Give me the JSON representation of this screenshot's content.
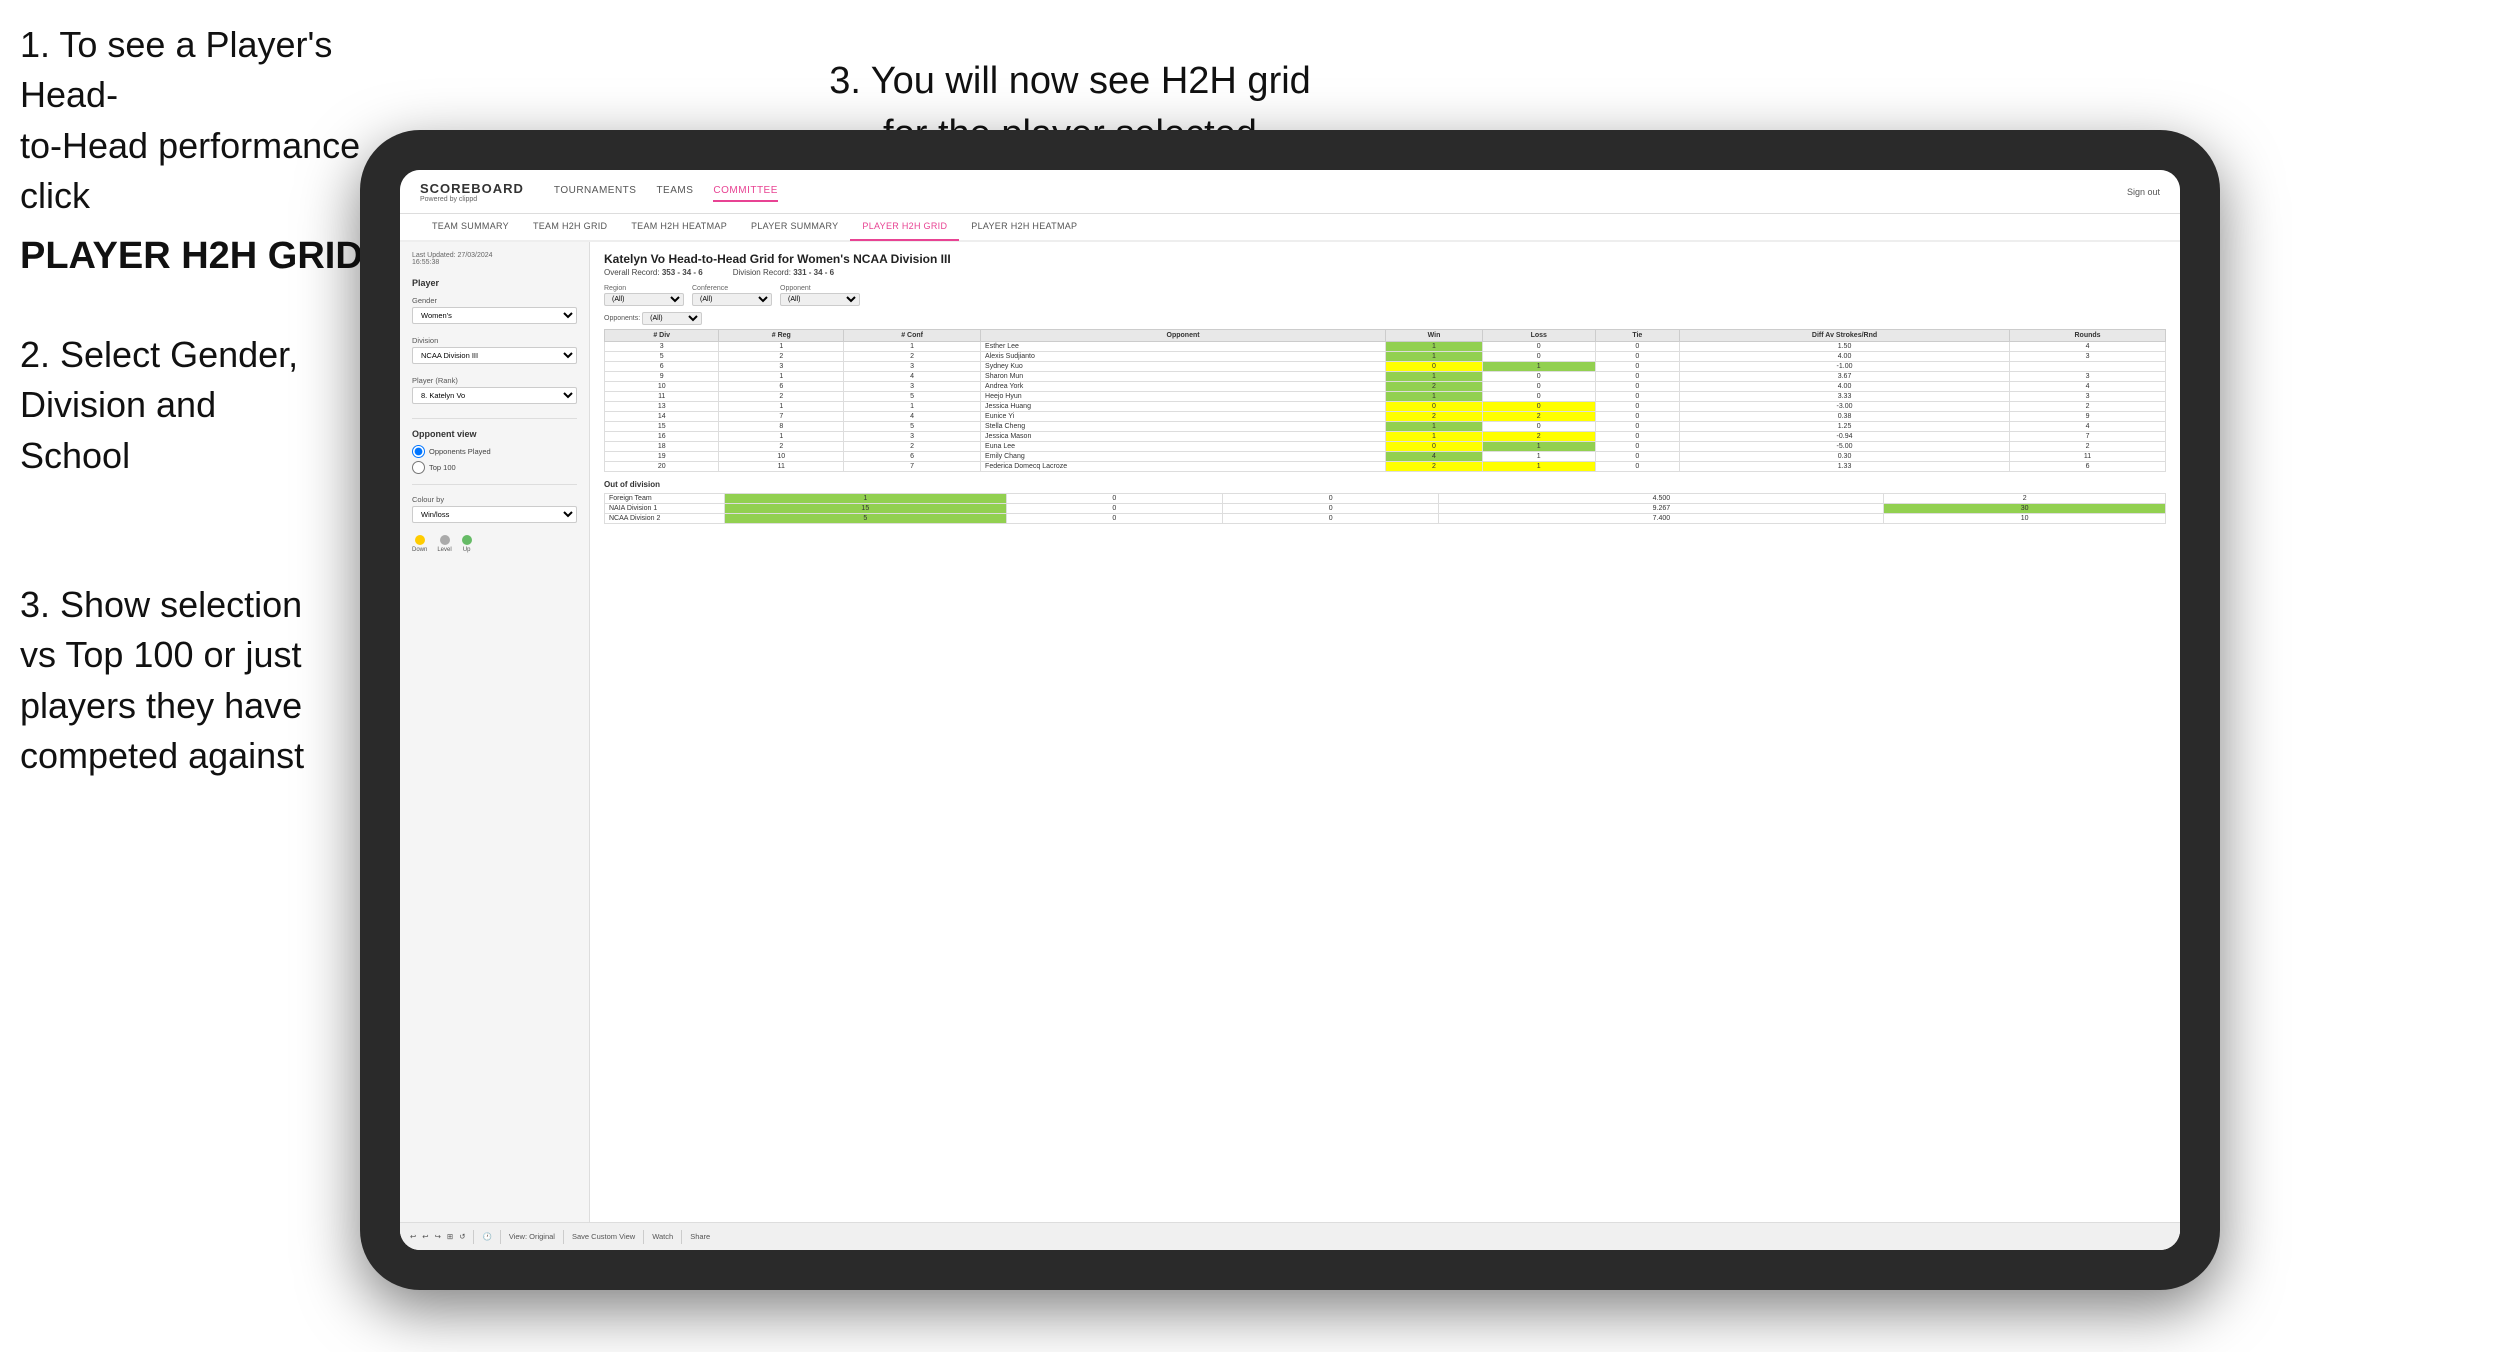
{
  "instructions": {
    "step1_line1": "1. To see a Player's Head-",
    "step1_line2": "to-Head performance click",
    "step1_bold": "PLAYER H2H GRID",
    "step2": "2. Select Gender,\nDivision and\nSchool",
    "step3_top_line1": "3. You will now see H2H grid",
    "step3_top_line2": "for the player selected",
    "step3_bottom": "3. Show selection\nvs Top 100 or just\nplayers they have\ncompeted against"
  },
  "nav": {
    "logo": "SCOREBOARD",
    "logo_sub": "Powered by clippd",
    "links": [
      "TOURNAMENTS",
      "TEAMS",
      "COMMITTEE"
    ],
    "active_link": "COMMITTEE",
    "sign_out": "Sign out"
  },
  "sub_nav": {
    "links": [
      "TEAM SUMMARY",
      "TEAM H2H GRID",
      "TEAM H2H HEATMAP",
      "PLAYER SUMMARY",
      "PLAYER H2H GRID",
      "PLAYER H2H HEATMAP"
    ],
    "active": "PLAYER H2H GRID"
  },
  "sidebar": {
    "timestamp": "Last Updated: 27/03/2024",
    "time": "16:55:38",
    "player_section": "Player",
    "gender_label": "Gender",
    "gender_value": "Women's",
    "division_label": "Division",
    "division_value": "NCAA Division III",
    "player_rank_label": "Player (Rank)",
    "player_rank_value": "8. Katelyn Vo",
    "opponent_view_label": "Opponent view",
    "opponents_played": "Opponents Played",
    "top_100": "Top 100",
    "colour_by": "Colour by",
    "colour_by_value": "Win/loss",
    "legend": {
      "down_label": "Down",
      "level_label": "Level",
      "up_label": "Up",
      "down_color": "#ffcc00",
      "level_color": "#aaaaaa",
      "up_color": "#66bb66"
    }
  },
  "grid": {
    "title": "Katelyn Vo Head-to-Head Grid for Women's NCAA Division III",
    "overall_record_label": "Overall Record:",
    "overall_record": "353 - 34 - 6",
    "division_record_label": "Division Record:",
    "division_record": "331 - 34 - 6",
    "region_filter_label": "Region",
    "conference_filter_label": "Conference",
    "opponent_filter_label": "Opponent",
    "opponents_label": "Opponents:",
    "filter_all": "(All)",
    "col_headers": [
      "# Div",
      "# Reg",
      "# Conf",
      "Opponent",
      "Win",
      "Loss",
      "Tie",
      "Diff Av Strokes/Rnd",
      "Rounds"
    ],
    "rows": [
      {
        "div": "3",
        "reg": "1",
        "conf": "1",
        "opponent": "Esther Lee",
        "win": "1",
        "loss": "0",
        "tie": "0",
        "diff": "1.50",
        "rounds": "4",
        "win_color": "green",
        "loss_color": "",
        "tie_color": ""
      },
      {
        "div": "5",
        "reg": "2",
        "conf": "2",
        "opponent": "Alexis Sudjianto",
        "win": "1",
        "loss": "0",
        "tie": "0",
        "diff": "4.00",
        "rounds": "3",
        "win_color": "green",
        "loss_color": "",
        "tie_color": ""
      },
      {
        "div": "6",
        "reg": "3",
        "conf": "3",
        "opponent": "Sydney Kuo",
        "win": "0",
        "loss": "1",
        "tie": "0",
        "diff": "-1.00",
        "rounds": "",
        "win_color": "yellow",
        "loss_color": "green",
        "tie_color": ""
      },
      {
        "div": "9",
        "reg": "1",
        "conf": "4",
        "opponent": "Sharon Mun",
        "win": "1",
        "loss": "0",
        "tie": "0",
        "diff": "3.67",
        "rounds": "3",
        "win_color": "green",
        "loss_color": "",
        "tie_color": ""
      },
      {
        "div": "10",
        "reg": "6",
        "conf": "3",
        "opponent": "Andrea York",
        "win": "2",
        "loss": "0",
        "tie": "0",
        "diff": "4.00",
        "rounds": "4",
        "win_color": "green",
        "loss_color": "",
        "tie_color": ""
      },
      {
        "div": "11",
        "reg": "2",
        "conf": "5",
        "opponent": "Heejo Hyun",
        "win": "1",
        "loss": "0",
        "tie": "0",
        "diff": "3.33",
        "rounds": "3",
        "win_color": "green",
        "loss_color": "",
        "tie_color": ""
      },
      {
        "div": "13",
        "reg": "1",
        "conf": "1",
        "opponent": "Jessica Huang",
        "win": "0",
        "loss": "0",
        "tie": "0",
        "diff": "-3.00",
        "rounds": "2",
        "win_color": "yellow",
        "loss_color": "yellow",
        "tie_color": ""
      },
      {
        "div": "14",
        "reg": "7",
        "conf": "4",
        "opponent": "Eunice Yi",
        "win": "2",
        "loss": "2",
        "tie": "0",
        "diff": "0.38",
        "rounds": "9",
        "win_color": "yellow",
        "loss_color": "yellow",
        "tie_color": ""
      },
      {
        "div": "15",
        "reg": "8",
        "conf": "5",
        "opponent": "Stella Cheng",
        "win": "1",
        "loss": "0",
        "tie": "0",
        "diff": "1.25",
        "rounds": "4",
        "win_color": "green",
        "loss_color": "",
        "tie_color": ""
      },
      {
        "div": "16",
        "reg": "1",
        "conf": "3",
        "opponent": "Jessica Mason",
        "win": "1",
        "loss": "2",
        "tie": "0",
        "diff": "-0.94",
        "rounds": "7",
        "win_color": "yellow",
        "loss_color": "yellow",
        "tie_color": ""
      },
      {
        "div": "18",
        "reg": "2",
        "conf": "2",
        "opponent": "Euna Lee",
        "win": "0",
        "loss": "1",
        "tie": "0",
        "diff": "-5.00",
        "rounds": "2",
        "win_color": "yellow",
        "loss_color": "green",
        "tie_color": ""
      },
      {
        "div": "19",
        "reg": "10",
        "conf": "6",
        "opponent": "Emily Chang",
        "win": "4",
        "loss": "1",
        "tie": "0",
        "diff": "0.30",
        "rounds": "11",
        "win_color": "green",
        "loss_color": "",
        "tie_color": ""
      },
      {
        "div": "20",
        "reg": "11",
        "conf": "7",
        "opponent": "Federica Domecq Lacroze",
        "win": "2",
        "loss": "1",
        "tie": "0",
        "diff": "1.33",
        "rounds": "6",
        "win_color": "yellow",
        "loss_color": "yellow",
        "tie_color": ""
      }
    ],
    "out_of_division": "Out of division",
    "out_rows": [
      {
        "team": "Foreign Team",
        "win": "1",
        "loss": "0",
        "tie": "0",
        "diff": "4.500",
        "rounds": "2"
      },
      {
        "team": "NAIA Division 1",
        "win": "15",
        "loss": "0",
        "tie": "0",
        "diff": "9.267",
        "rounds": "30"
      },
      {
        "team": "NCAA Division 2",
        "win": "5",
        "loss": "0",
        "tie": "0",
        "diff": "7.400",
        "rounds": "10"
      }
    ]
  },
  "toolbar": {
    "view_original": "View: Original",
    "save_custom": "Save Custom View",
    "watch": "Watch",
    "share": "Share"
  }
}
